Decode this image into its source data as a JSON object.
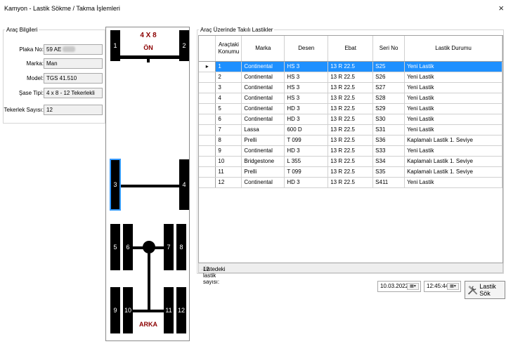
{
  "window": {
    "title": "Kamyon - Lastik Sökme / Takma İşlemleri",
    "close": "×"
  },
  "vehicle_info": {
    "legend": "Araç Bilgileri",
    "fields": [
      {
        "label": "Plaka No:",
        "value": "59 AE"
      },
      {
        "label": "Marka:",
        "value": "Man"
      },
      {
        "label": "Model:",
        "value": "TGS 41.510"
      },
      {
        "label": "Şase Tipi:",
        "value": "4 x 8 - 12 Tekerlekli"
      },
      {
        "label": "Tekerlek Sayısı:",
        "value": "12"
      }
    ]
  },
  "truck": {
    "config": "4 X 8",
    "front": "ÖN",
    "rear": "ARKA",
    "tires": [
      "1",
      "2",
      "3",
      "4",
      "5",
      "6",
      "7",
      "8",
      "9",
      "10",
      "11",
      "12"
    ],
    "selected_tire": "3"
  },
  "tires_list": {
    "legend": "Araç Üzerinde Takılı Lastikler",
    "columns": [
      "Araçtaki Konumu",
      "Marka",
      "Desen",
      "Ebat",
      "Seri No",
      "Lastik Durumu"
    ],
    "rows": [
      [
        "1",
        "Continental",
        "HS 3",
        "13 R 22.5",
        "S25",
        "Yeni Lastik"
      ],
      [
        "2",
        "Continental",
        "HS 3",
        "13 R 22.5",
        "S26",
        "Yeni Lastik"
      ],
      [
        "3",
        "Continental",
        "HS 3",
        "13 R 22.5",
        "S27",
        "Yeni Lastik"
      ],
      [
        "4",
        "Continental",
        "HS 3",
        "13 R 22.5",
        "S28",
        "Yeni Lastik"
      ],
      [
        "5",
        "Continental",
        "HD 3",
        "13 R 22.5",
        "S29",
        "Yeni Lastik"
      ],
      [
        "6",
        "Continental",
        "HD 3",
        "13 R 22.5",
        "S30",
        "Yeni Lastik"
      ],
      [
        "7",
        "Lassa",
        "600 D",
        "13 R 22.5",
        "S31",
        "Yeni Lastik"
      ],
      [
        "8",
        "Prelli",
        "T 099",
        "13 R 22.5",
        "S36",
        "Kaplamalı Lastik 1. Seviye"
      ],
      [
        "9",
        "Continental",
        "HD 3",
        "13 R 22.5",
        "S33",
        "Yeni Lastik"
      ],
      [
        "10",
        "Bridgestone",
        "L 355",
        "13 R 22.5",
        "S34",
        "Kaplamalı Lastik 1. Seviye"
      ],
      [
        "11",
        "Prelli",
        "T 099",
        "13 R 22.5",
        "S35",
        "Kaplamalı Lastik 1. Seviye"
      ],
      [
        "12",
        "Continental",
        "HD 3",
        "13 R 22.5",
        "S411",
        "Yeni Lastik"
      ]
    ],
    "selected_row": 0,
    "count_label": "Listedeki lastik sayısı:",
    "count_value": "12"
  },
  "controls": {
    "date": "10.03.2022",
    "time": "12:45:44",
    "action_label": "Lastik Sök",
    "action_icon": "tools-icon",
    "calendar_icon": "calendar-dropdown-icon"
  },
  "colors": {
    "selection": "#1e90ff",
    "axle_title": "#8b0000",
    "tire": "#000000",
    "highlight": "#3399ff"
  }
}
